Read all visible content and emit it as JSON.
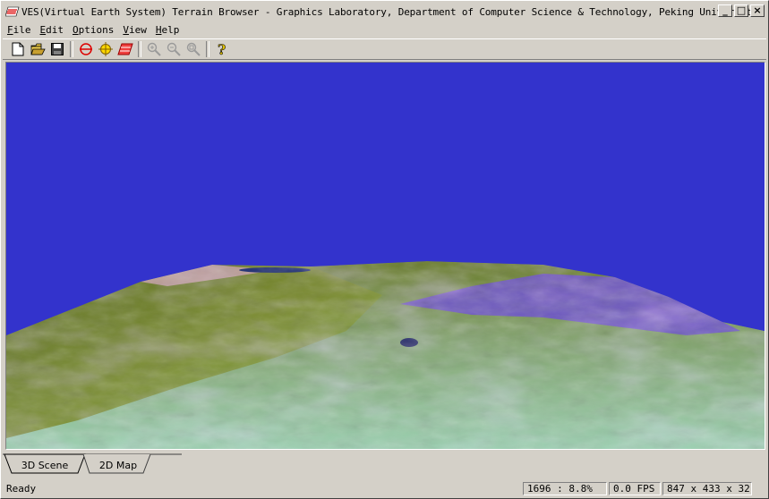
{
  "window": {
    "title": "VES(Virtual Earth System) Terrain Browser - Graphics Laboratory, Department of Computer Science & Technology, Peking University.",
    "minimize_label": "_",
    "maximize_label": "□",
    "close_label": "×"
  },
  "menu": {
    "items": [
      {
        "underline": "F",
        "rest": "ile"
      },
      {
        "underline": "E",
        "rest": "dit"
      },
      {
        "underline": "O",
        "rest": "ptions"
      },
      {
        "underline": "V",
        "rest": "iew"
      },
      {
        "underline": "H",
        "rest": "elp"
      }
    ]
  },
  "toolbar": {
    "icons": [
      "new-file-icon",
      "open-folder-icon",
      "save-disk-icon",
      "red-globe-icon",
      "yellow-target-icon",
      "terrain-layer-icon",
      "zoom-in-icon",
      "zoom-out-icon",
      "zoom-fit-icon",
      "help-icon"
    ]
  },
  "scene": {
    "sky_color": "#3333cc"
  },
  "tabs": {
    "items": [
      "3D Scene",
      "2D Map"
    ],
    "active": 0
  },
  "status": {
    "ready": "Ready",
    "progress": "1696 : 8.8%",
    "fps": "0.0 FPS",
    "resolution": "847 x 433 x 32"
  }
}
